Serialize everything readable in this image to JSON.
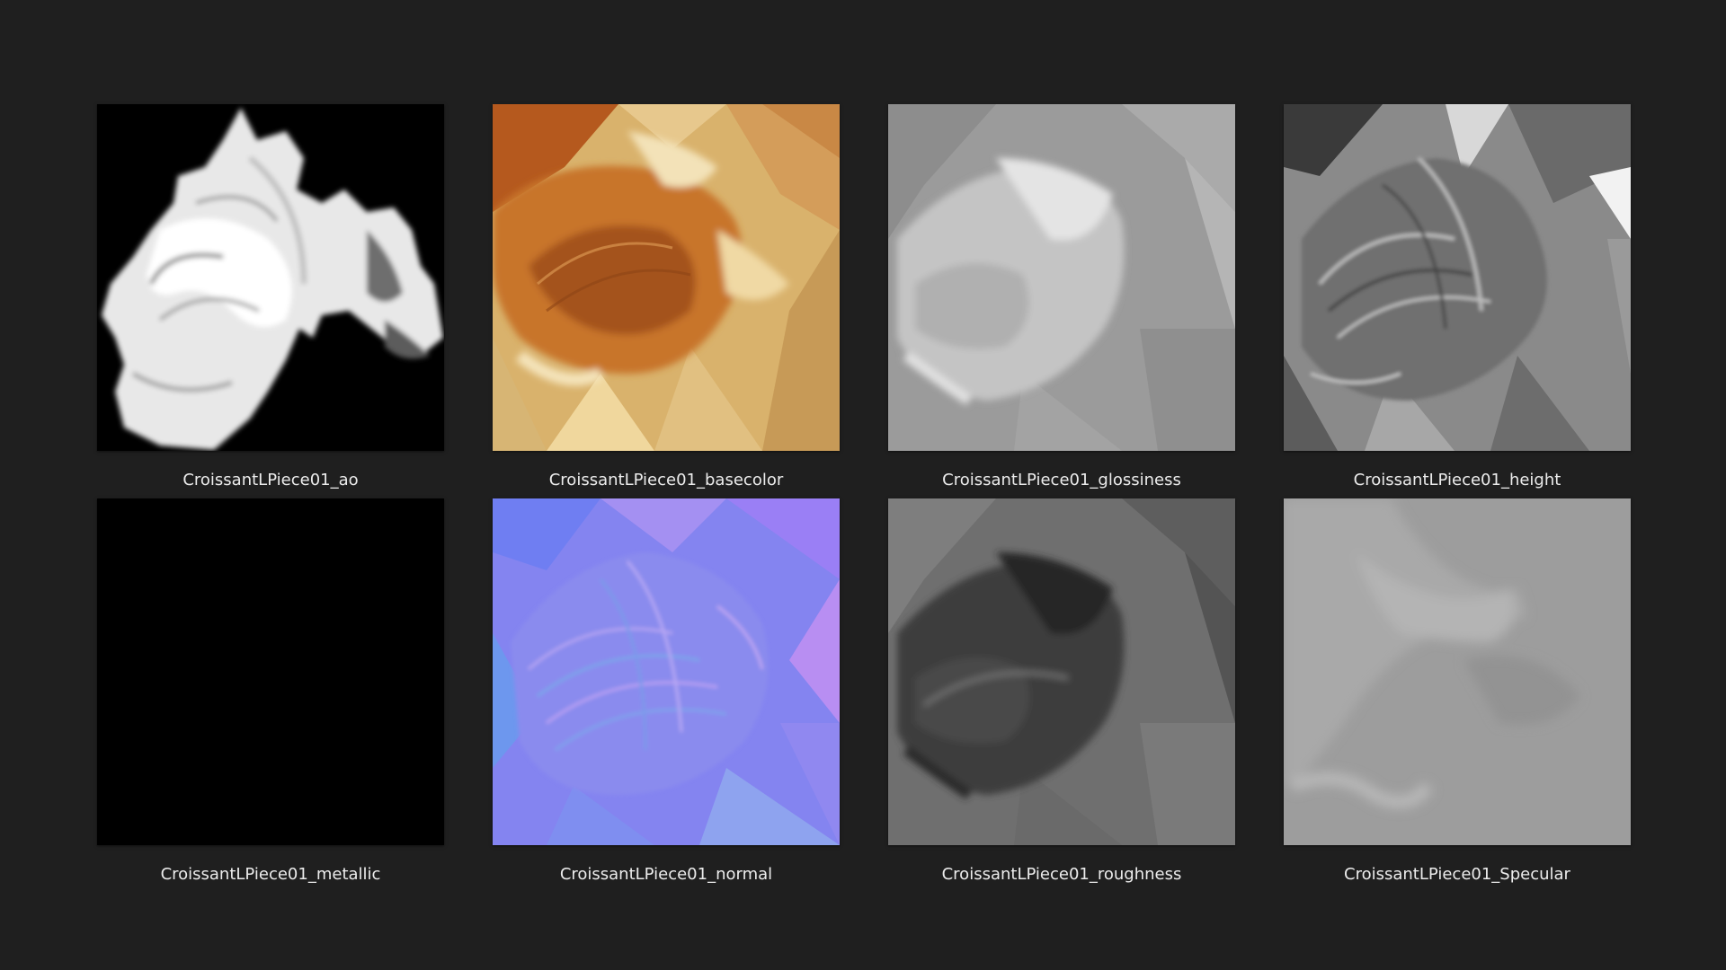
{
  "files": [
    {
      "name": "CroissantLPiece01_ao",
      "icon": "ao-texture-thumbnail"
    },
    {
      "name": "CroissantLPiece01_basecolor",
      "icon": "basecolor-texture-thumbnail"
    },
    {
      "name": "CroissantLPiece01_glossiness",
      "icon": "glossiness-texture-thumbnail"
    },
    {
      "name": "CroissantLPiece01_height",
      "icon": "height-texture-thumbnail"
    },
    {
      "name": "CroissantLPiece01_metallic",
      "icon": "metallic-texture-thumbnail"
    },
    {
      "name": "CroissantLPiece01_normal",
      "icon": "normal-texture-thumbnail"
    },
    {
      "name": "CroissantLPiece01_roughness",
      "icon": "roughness-texture-thumbnail"
    },
    {
      "name": "CroissantLPiece01_Specular",
      "icon": "specular-texture-thumbnail"
    }
  ],
  "colors": {
    "background": "#1f1f1f",
    "caption_text": "#ececec"
  }
}
